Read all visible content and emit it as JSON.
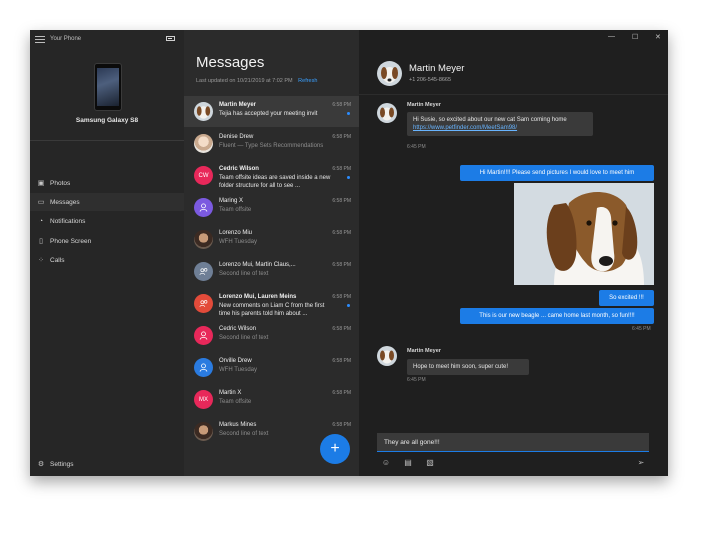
{
  "app": {
    "title": "Your Phone"
  },
  "device": {
    "name": "Samsung Galaxy S8"
  },
  "nav": {
    "items": [
      {
        "label": "Photos",
        "icon": "photo-icon"
      },
      {
        "label": "Messages",
        "icon": "message-icon"
      },
      {
        "label": "Notifications",
        "icon": "bell-icon"
      },
      {
        "label": "Phone Screen",
        "icon": "phone-screen-icon"
      },
      {
        "label": "Calls",
        "icon": "dialpad-icon"
      }
    ],
    "settings_label": "Settings"
  },
  "messages": {
    "title": "Messages",
    "updated": "Last updated on 10/21/2019 at 7:02 PM",
    "refresh": "Refresh",
    "new_button": "+",
    "conversations": [
      {
        "name": "Martin Meyer",
        "time": "6:58 PM",
        "preview": "Tejia has accepted your meeting invit",
        "unread": true,
        "selected": true,
        "avatar_type": "dog",
        "initials": ""
      },
      {
        "name": "Denise Drew",
        "time": "6:58 PM",
        "preview": "Fluent — Type Sets Recommendations",
        "unread": false,
        "selected": false,
        "avatar_type": "photo-light",
        "initials": ""
      },
      {
        "name": "Cedric Wilson",
        "time": "6:58 PM",
        "preview": "Team offsite ideas are saved inside a new folder structure for all to see ...",
        "unread": true,
        "selected": false,
        "avatar_type": "initials",
        "color": "#e8285a",
        "initials": "CW"
      },
      {
        "name": "Maring X",
        "time": "6:58 PM",
        "preview": "Team offsite",
        "unread": false,
        "selected": false,
        "avatar_type": "person",
        "color": "#7b5ae0",
        "initials": ""
      },
      {
        "name": "Lorenzo Miu",
        "time": "6:58 PM",
        "preview": "WFH Tuesday",
        "unread": false,
        "selected": false,
        "avatar_type": "photo-dark",
        "initials": ""
      },
      {
        "name": "Lorenzo Mui, Martin Claus,...",
        "time": "6:58 PM",
        "preview": "Second line of text",
        "unread": false,
        "selected": false,
        "avatar_type": "group",
        "color": "#6f7f96",
        "initials": ""
      },
      {
        "name": "Lorenzo Mui, Lauren Meins",
        "time": "6:58 PM",
        "preview": "New comments on Liam C from the first time his parents told him about ...",
        "unread": true,
        "selected": false,
        "avatar_type": "group",
        "color": "#e34b3a",
        "initials": ""
      },
      {
        "name": "Cedric Wilson",
        "time": "6:58 PM",
        "preview": "Second line of text",
        "unread": false,
        "selected": false,
        "avatar_type": "person",
        "color": "#e8285a",
        "initials": ""
      },
      {
        "name": "Orville Drew",
        "time": "6:58 PM",
        "preview": "WFH Tuesday",
        "unread": false,
        "selected": false,
        "avatar_type": "person",
        "color": "#2a7be0",
        "initials": ""
      },
      {
        "name": "Martin X",
        "time": "6:58 PM",
        "preview": "Team offsite",
        "unread": false,
        "selected": false,
        "avatar_type": "initials",
        "color": "#e8285a",
        "initials": "MX"
      },
      {
        "name": "Markus Mines",
        "time": "6:58 PM",
        "preview": "Second line of text",
        "unread": false,
        "selected": false,
        "avatar_type": "photo-dark",
        "initials": ""
      }
    ]
  },
  "chat": {
    "contact_name": "Martin Meyer",
    "contact_phone": "+1 206-545-8665",
    "msg1": {
      "sender": "Martin Meyer",
      "text": "Hi Susie, so excited about our new cat Sam coming home",
      "link": "https://www.petfinder.com/MeetSam98/",
      "time": "6:45 PM"
    },
    "msg2": {
      "text": "Hi Martin!!!! Please send pictures I would love to meet him"
    },
    "msg3": {
      "text": "So excited !!!"
    },
    "msg4": {
      "text": "This is our new beagle ... came home last month, so fun!!!!",
      "time": "6:45 PM"
    },
    "msg5": {
      "sender": "Martin Meyer",
      "text": "Hope to meet him soon, super cute!",
      "time": "6:45 PM"
    },
    "composer_text": "They are all gone!!!"
  },
  "colors": {
    "accent": "#1c7ce6",
    "link": "#3aa0ff"
  }
}
